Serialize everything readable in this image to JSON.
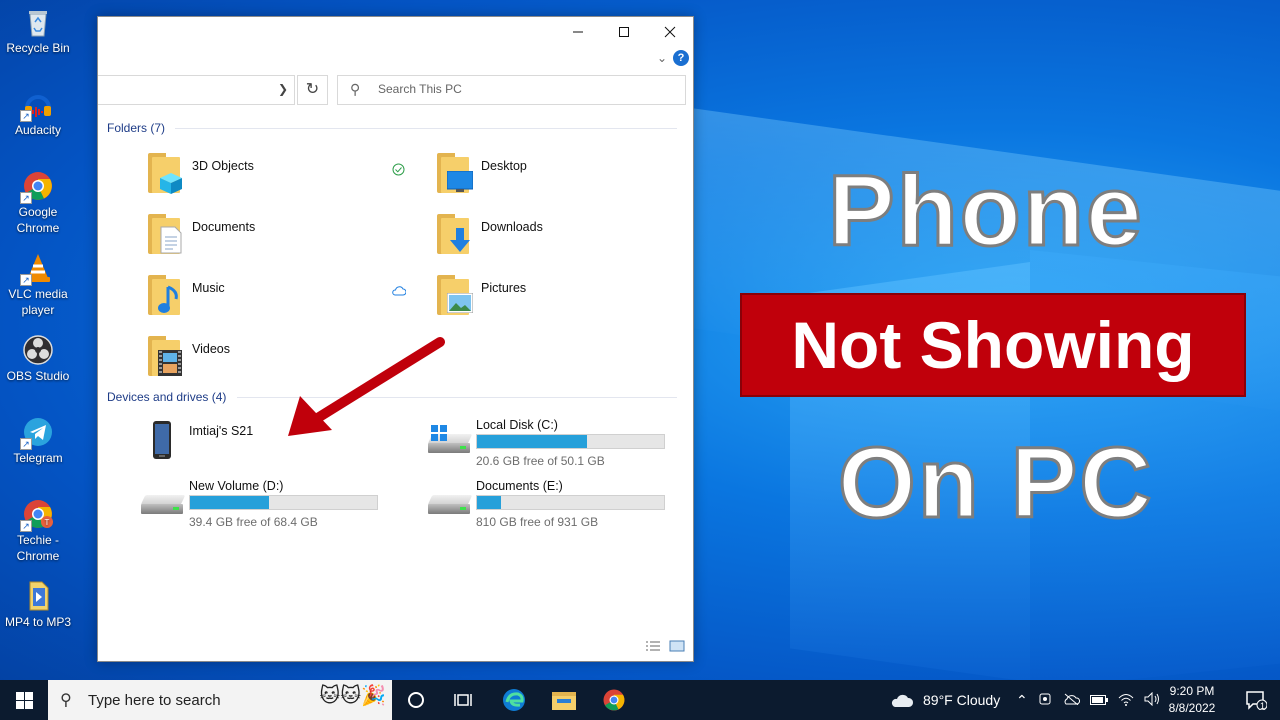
{
  "desktop": {
    "icons": [
      {
        "label": "Recycle Bin",
        "icon": "recycle-bin-icon"
      },
      {
        "label": "Audacity",
        "icon": "audacity-icon"
      },
      {
        "label": "Google Chrome",
        "icon": "chrome-icon"
      },
      {
        "label": "VLC media player",
        "icon": "vlc-icon"
      },
      {
        "label": "OBS Studio",
        "icon": "obs-icon"
      },
      {
        "label": "Telegram",
        "icon": "telegram-icon"
      },
      {
        "label": "Techie - Chrome",
        "icon": "chrome-profile-icon"
      },
      {
        "label": "MP4 to MP3",
        "icon": "file-icon"
      }
    ]
  },
  "explorer": {
    "search_placeholder": "Search This PC",
    "folders_header": "Folders (7)",
    "folders": [
      {
        "name": "3D Objects",
        "icon": "3d-objects-folder-icon"
      },
      {
        "name": "Desktop",
        "icon": "desktop-folder-icon"
      },
      {
        "name": "Documents",
        "icon": "documents-folder-icon"
      },
      {
        "name": "Downloads",
        "icon": "downloads-folder-icon"
      },
      {
        "name": "Music",
        "icon": "music-folder-icon"
      },
      {
        "name": "Pictures",
        "icon": "pictures-folder-icon"
      },
      {
        "name": "Videos",
        "icon": "videos-folder-icon"
      }
    ],
    "devices_header": "Devices and drives (4)",
    "devices": [
      {
        "name": "Imtiaj's S21",
        "icon": "phone-icon"
      },
      {
        "name": "Local Disk (C:)",
        "free": "20.6 GB free of 50.1 GB",
        "used_fraction": 0.589,
        "icon": "windows-drive-icon"
      },
      {
        "name": "New Volume (D:)",
        "free": "39.4 GB free of 68.4 GB",
        "used_fraction": 0.424,
        "icon": "hard-drive-icon"
      },
      {
        "name": "Documents (E:)",
        "free": "810 GB free of 931 GB",
        "used_fraction": 0.13,
        "icon": "hard-drive-icon"
      }
    ],
    "colors": {
      "bar_fill": "#26a0da",
      "group_header": "#1e3c87"
    }
  },
  "headline": {
    "line1": "Phone",
    "line2": "Not Showing",
    "line3": "On PC",
    "banner_color": "#c0000b"
  },
  "taskbar": {
    "search_placeholder": "Type here to search",
    "weather": "89°F  Cloudy",
    "time": "9:20 PM",
    "date": "8/8/2022",
    "notification_count": "1"
  }
}
